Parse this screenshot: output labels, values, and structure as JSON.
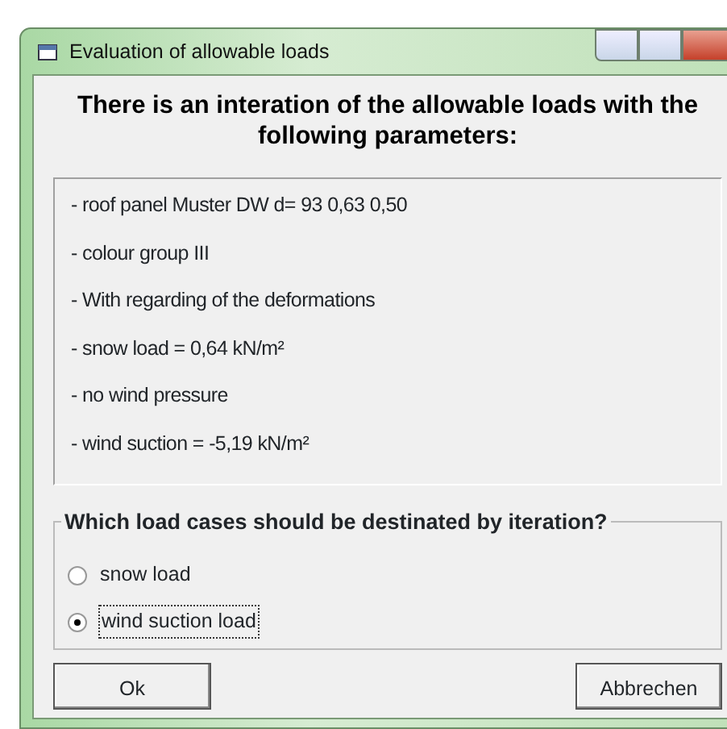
{
  "window": {
    "title": "Evaluation of allowable loads"
  },
  "heading": "There is an interation of the allowable loads with the following parameters:",
  "parameters": [
    "- roof panel Muster DW d= 93 0,63 0,50",
    "- colour group III",
    "- With regarding of the deformations",
    "- snow load = 0,64 kN/m²",
    "- no wind pressure",
    "- wind suction = -5,19 kN/m²"
  ],
  "load_cases": {
    "legend": "Which load cases should be destinated by iteration?",
    "options": [
      {
        "label": "snow load",
        "selected": false
      },
      {
        "label": "wind suction load",
        "selected": true
      }
    ]
  },
  "buttons": [
    {
      "label": "Ok"
    },
    {
      "label": "Abbrechen"
    }
  ]
}
